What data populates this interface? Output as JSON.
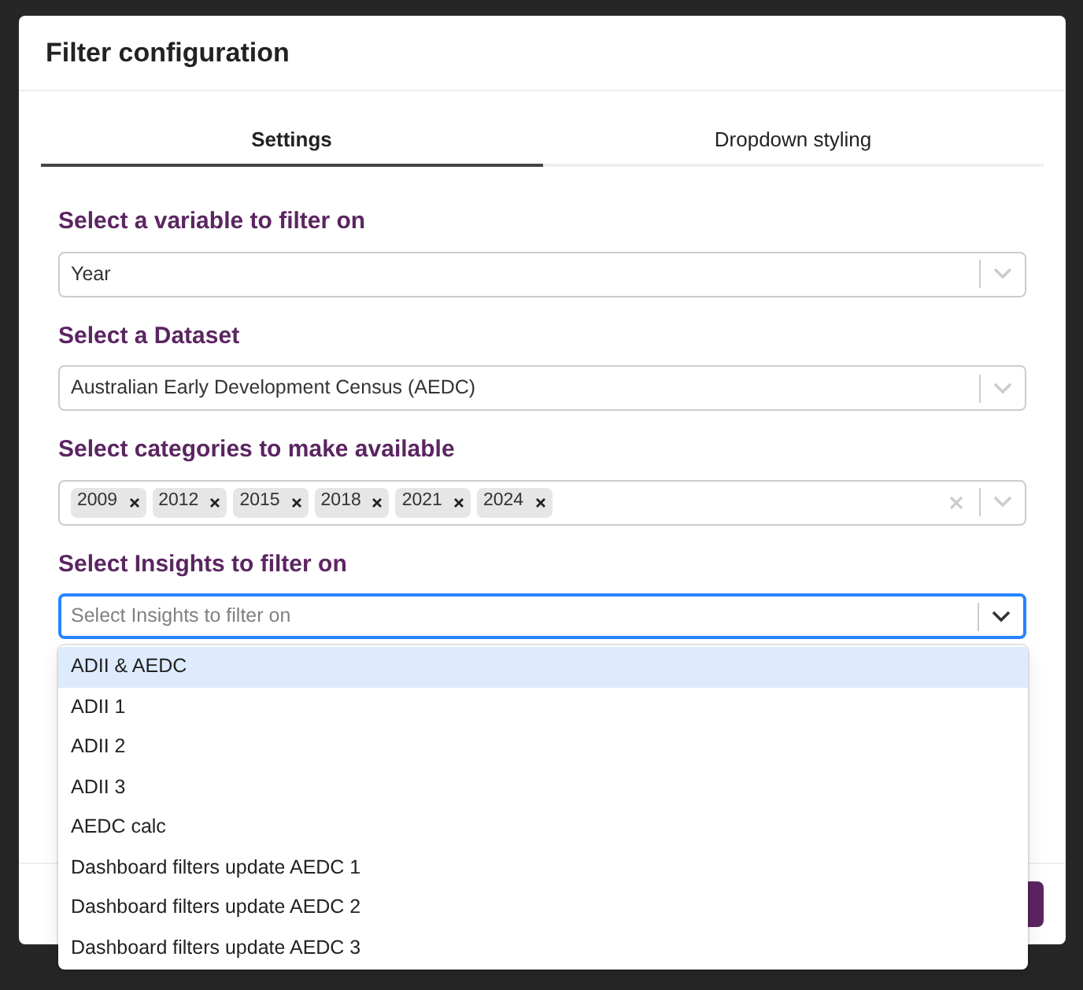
{
  "dialog": {
    "title": "Filter configuration"
  },
  "tabs": [
    {
      "label": "Settings",
      "selected": true
    },
    {
      "label": "Dropdown styling",
      "selected": false
    }
  ],
  "sections": [
    {
      "label": "Select a variable to filter on",
      "kind": "select",
      "value": "Year",
      "focused": false
    },
    {
      "label": "Select a Dataset",
      "kind": "select",
      "value": "Australian Early Development Census (AEDC)",
      "focused": false
    },
    {
      "label": "Select categories to make available",
      "kind": "multi",
      "tags": [
        "2009",
        "2012",
        "2015",
        "2018",
        "2021",
        "2024"
      ],
      "focused": false
    },
    {
      "label": "Select Insights to filter on",
      "kind": "select",
      "placeholder": "Select Insights to filter on",
      "focused": true
    }
  ],
  "dropdown": {
    "options": [
      {
        "label": "ADII & AEDC",
        "highlighted": true
      },
      {
        "label": "ADII 1",
        "highlighted": false
      },
      {
        "label": "ADII 2",
        "highlighted": false
      },
      {
        "label": "ADII 3",
        "highlighted": false
      },
      {
        "label": "AEDC calc",
        "highlighted": false
      },
      {
        "label": "Dashboard filters update AEDC 1",
        "highlighted": false
      },
      {
        "label": "Dashboard filters update AEDC 2",
        "highlighted": false
      },
      {
        "label": "Dashboard filters update AEDC 3",
        "highlighted": false
      }
    ]
  }
}
